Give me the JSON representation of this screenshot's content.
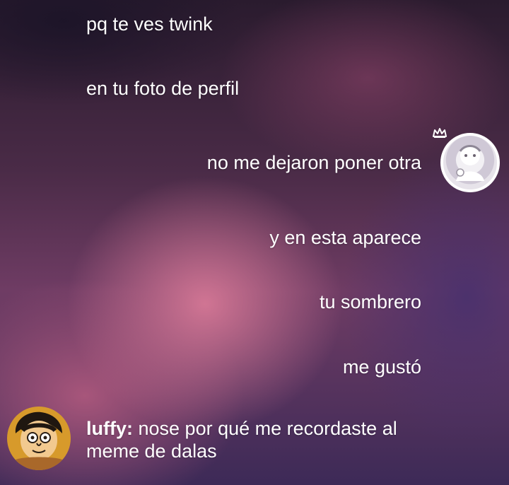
{
  "messages": [
    {
      "id": "m1",
      "side": "left",
      "text": "pq te ves twink"
    },
    {
      "id": "m2",
      "side": "left",
      "text": "en tu foto de perfil"
    },
    {
      "id": "m3",
      "side": "right",
      "text": "no me dejaron poner otra"
    },
    {
      "id": "m4",
      "side": "right",
      "text": "y en esta aparece"
    },
    {
      "id": "m5",
      "side": "right",
      "text": "tu sombrero"
    },
    {
      "id": "m6",
      "side": "right",
      "text": "me gustó"
    },
    {
      "id": "m7",
      "side": "left",
      "sender": "luffy:",
      "text": "nose por qué me recordaste al meme de dalas"
    }
  ],
  "icons": {
    "crown": "crown-icon",
    "avatar_self": "profile-avatar",
    "avatar_luffy": "luffy-avatar"
  },
  "colors": {
    "text": "#ffffff",
    "accent_pink": "#d67896",
    "accent_purple": "#3d2a57"
  }
}
